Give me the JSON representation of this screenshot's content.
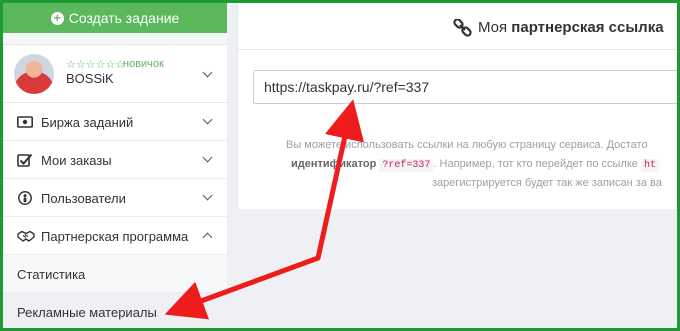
{
  "sidebar": {
    "create_task_label": "Создать задание",
    "user": {
      "stars": "☆☆☆☆☆☆",
      "rank": "новичок",
      "name": "BOSSiK"
    },
    "items": [
      {
        "label": "Биржа заданий",
        "icon": "money-icon"
      },
      {
        "label": "Мои заказы",
        "icon": "checkbox-icon"
      },
      {
        "label": "Пользователи",
        "icon": "users-icon"
      },
      {
        "label": "Партнерская программа",
        "icon": "handshake-icon"
      }
    ],
    "subitems": [
      {
        "label": "Статистика"
      },
      {
        "label": "Рекламные материалы"
      }
    ]
  },
  "main": {
    "title_prefix": "Моя ",
    "title_bold": "партнерская ссылка",
    "url_value": "https://taskpay.ru/?ref=337",
    "hint": {
      "line1": "Вы можете использовать ссылки на любую страницу сервиса. Достато",
      "line2_bold": "идентификатор",
      "line2_code": "?ref=337",
      "line2_rest": ". Например, тот кто перейдет по ссылке",
      "line2_code2": "ht",
      "line3": "зарегистрируется будет так же записан за ва"
    }
  },
  "colors": {
    "accent_green": "#5cb85c",
    "frame_green": "#1d9a34",
    "arrow_red": "#ee1c1c"
  }
}
